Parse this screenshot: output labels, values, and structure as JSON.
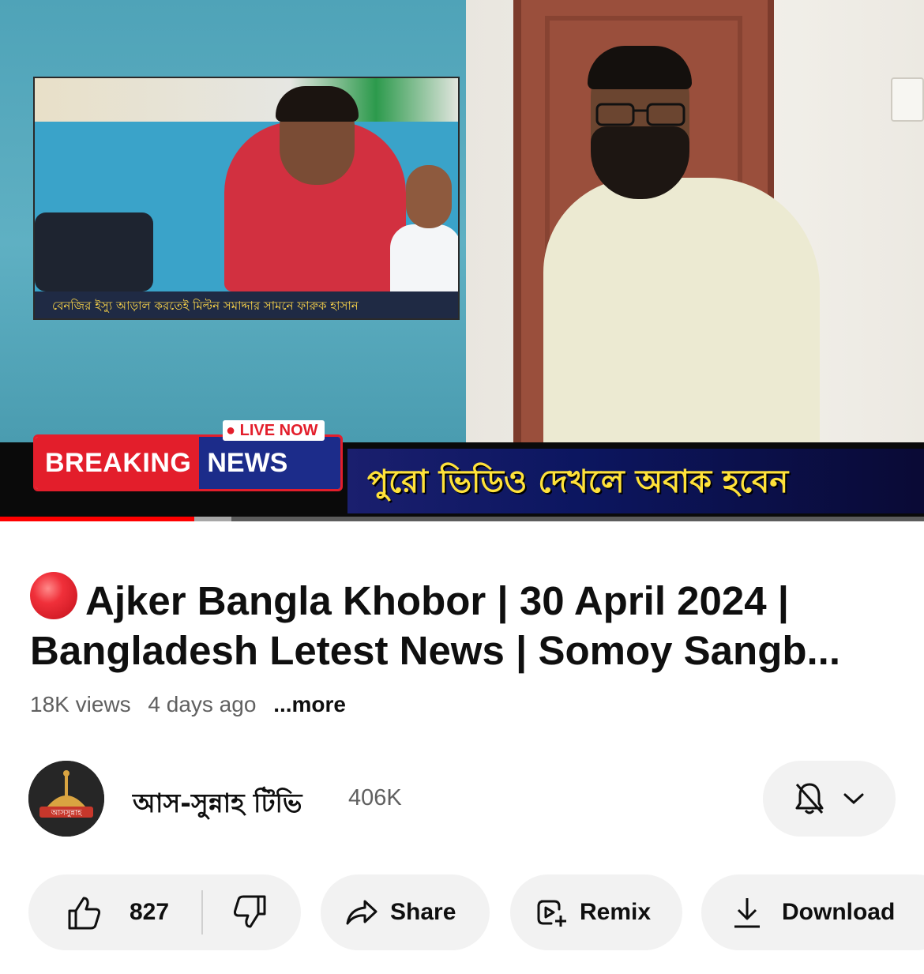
{
  "video": {
    "inset_caption": "বেনজির ইস্যু আড়াল করতেই মিল্টন সমাদ্দার সামনে ফারুক হাসান",
    "live_badge": "LIVE NOW",
    "breaking_word": "BREAKING",
    "news_word": "NEWS",
    "overlay_text": "পুরো ভিডিও দেখলে অবাক হবেন",
    "progress_fraction": 0.21,
    "buffered_fraction": 0.25,
    "colors": {
      "progress": "#ff0000",
      "breaking_red": "#e31e2b",
      "news_blue": "#1c2c8a",
      "overlay_text": "#ffe23a"
    }
  },
  "details": {
    "title_line1": "Ajker Bangla Khobor | 30 April  2024 |",
    "title_line2": "Bangladesh Letest News | Somoy Sangb...",
    "live_icon": "red-circle-icon",
    "views": "18K views",
    "age": "4 days ago",
    "more_label": "...more"
  },
  "channel": {
    "name": "আস-সুন্নাহ টিভি",
    "subscribers": "406K",
    "avatar_text": "আসসুন্নাহ",
    "notification_icon": "bell-off-icon",
    "dropdown_icon": "chevron-down-icon"
  },
  "actions": {
    "like_count": "827",
    "share_label": "Share",
    "remix_label": "Remix",
    "download_label": "Download"
  }
}
